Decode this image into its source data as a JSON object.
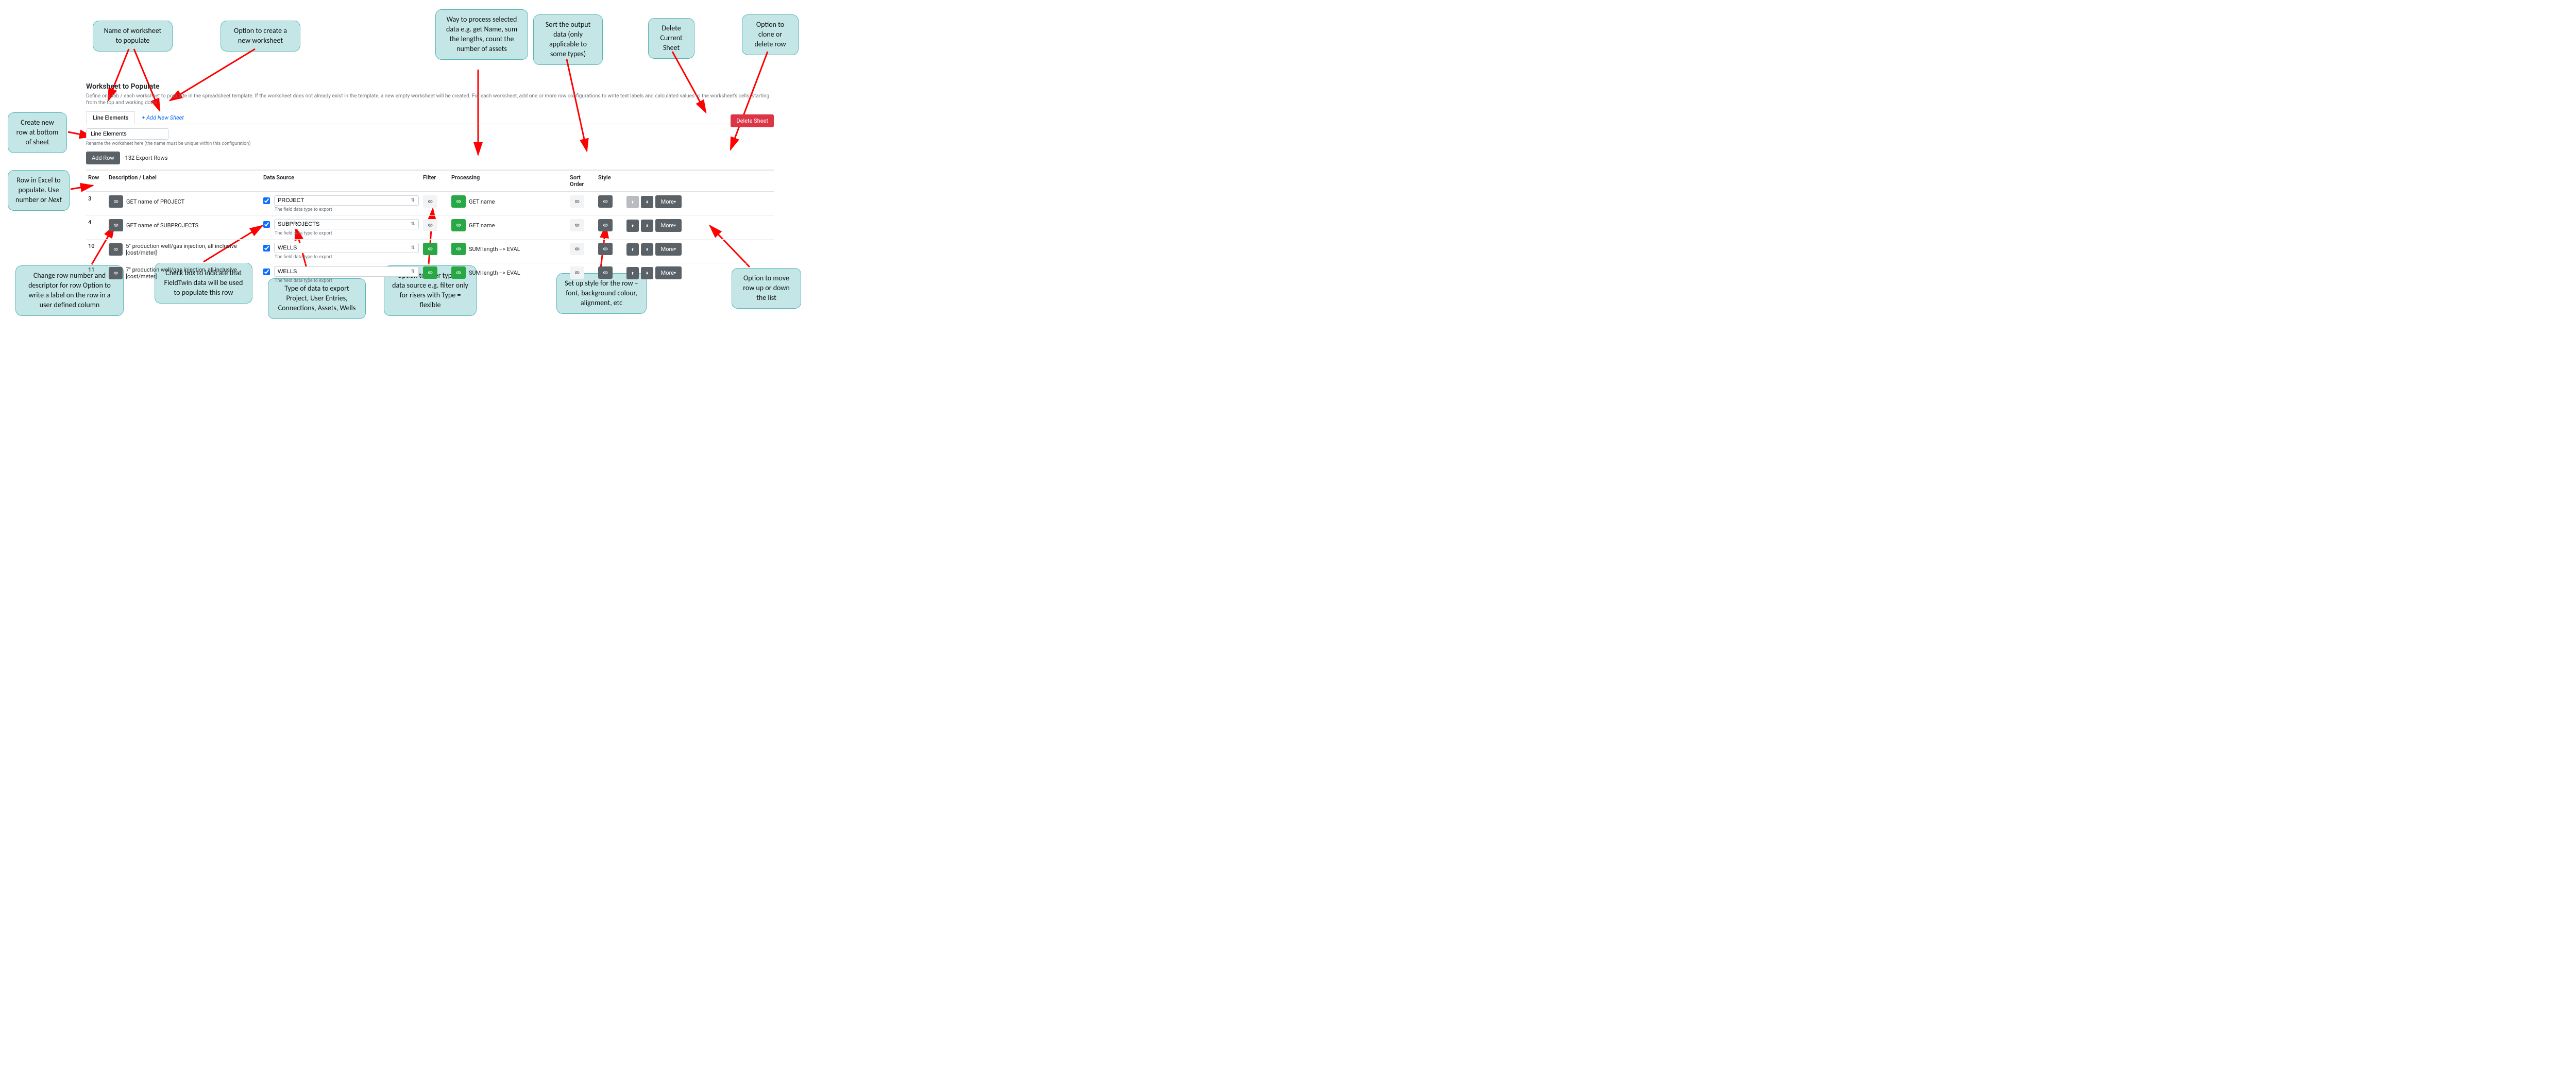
{
  "section": {
    "title": "Worksheet to Populate",
    "description": "Define one tab / each worksheet to populate in the spreadsheet template. If the worksheet does not already exist in the template, a new empty worksheet will be created. For each worksheet, add one or more row configurations to write text labels and calculated values to the worksheet's cells, starting from the top and working down."
  },
  "tabs": {
    "active": "Line Elements",
    "add": "+ Add New Sheet"
  },
  "rename": {
    "value": "Line Elements",
    "hint": "Rename the worksheet here (the name must be unique within this configuration)"
  },
  "addRow": {
    "label": "Add Row",
    "count": "132 Export Rows"
  },
  "deleteSheet": "Delete Sheet",
  "headers": {
    "row": "Row",
    "desc": "Description / Label",
    "ds": "Data Source",
    "filter": "Filter",
    "proc": "Processing",
    "sort": "Sort Order",
    "style": "Style"
  },
  "dsHint": "The field data type to export",
  "moreLabel": "More",
  "rows": [
    {
      "num": "3",
      "desc": "GET name of PROJECT",
      "checked": true,
      "source": "PROJECT",
      "filterGreen": false,
      "proc": "GET name",
      "upDisabled": true
    },
    {
      "num": "4",
      "desc": "GET name of SUBPROJECTS",
      "checked": true,
      "source": "SUBPROJECTS",
      "filterGreen": false,
      "proc": "GET name",
      "upDisabled": false
    },
    {
      "num": "10",
      "desc": "5\" production well/gas injection, all inclusive [cost/meter]",
      "checked": true,
      "source": "WELLS",
      "filterGreen": true,
      "proc": "SUM length --> EVAL",
      "upDisabled": false
    },
    {
      "num": "11",
      "desc": "7\" production well/gas injection, all inclusive [cost/meter]",
      "checked": true,
      "source": "WELLS",
      "filterGreen": true,
      "proc": "SUM length --> EVAL",
      "upDisabled": false
    }
  ],
  "callouts": {
    "c1": "Name of worksheet to populate",
    "c2": "Option to create a new worksheet",
    "c3": "Way to process selected data e.g. get Name, sum the lengths, count the number of assets",
    "c4": "Sort the output data (only applicable to some types)",
    "c5": "Delete Current Sheet",
    "c6": "Option to clone or delete row",
    "c7": "Create new row at bottom of sheet",
    "c8": "Row in Excel to populate. Use number or Next",
    "c9": "Change row number and descriptor for row Option to write a label on the row in a user defined column",
    "c10": "Check box to indicate that FieldTwin data will be used to populate this row",
    "c11": "Type of data to export Project, User Entries, Connections, Assets, Wells",
    "c12": "Option to filter type of data source e.g. filter only for risers with Type = flexible",
    "c13": "Set up style for the row – font, background colour, alignment, etc",
    "c14": "Option to move row up or down the list"
  },
  "nextItalic": "Next"
}
